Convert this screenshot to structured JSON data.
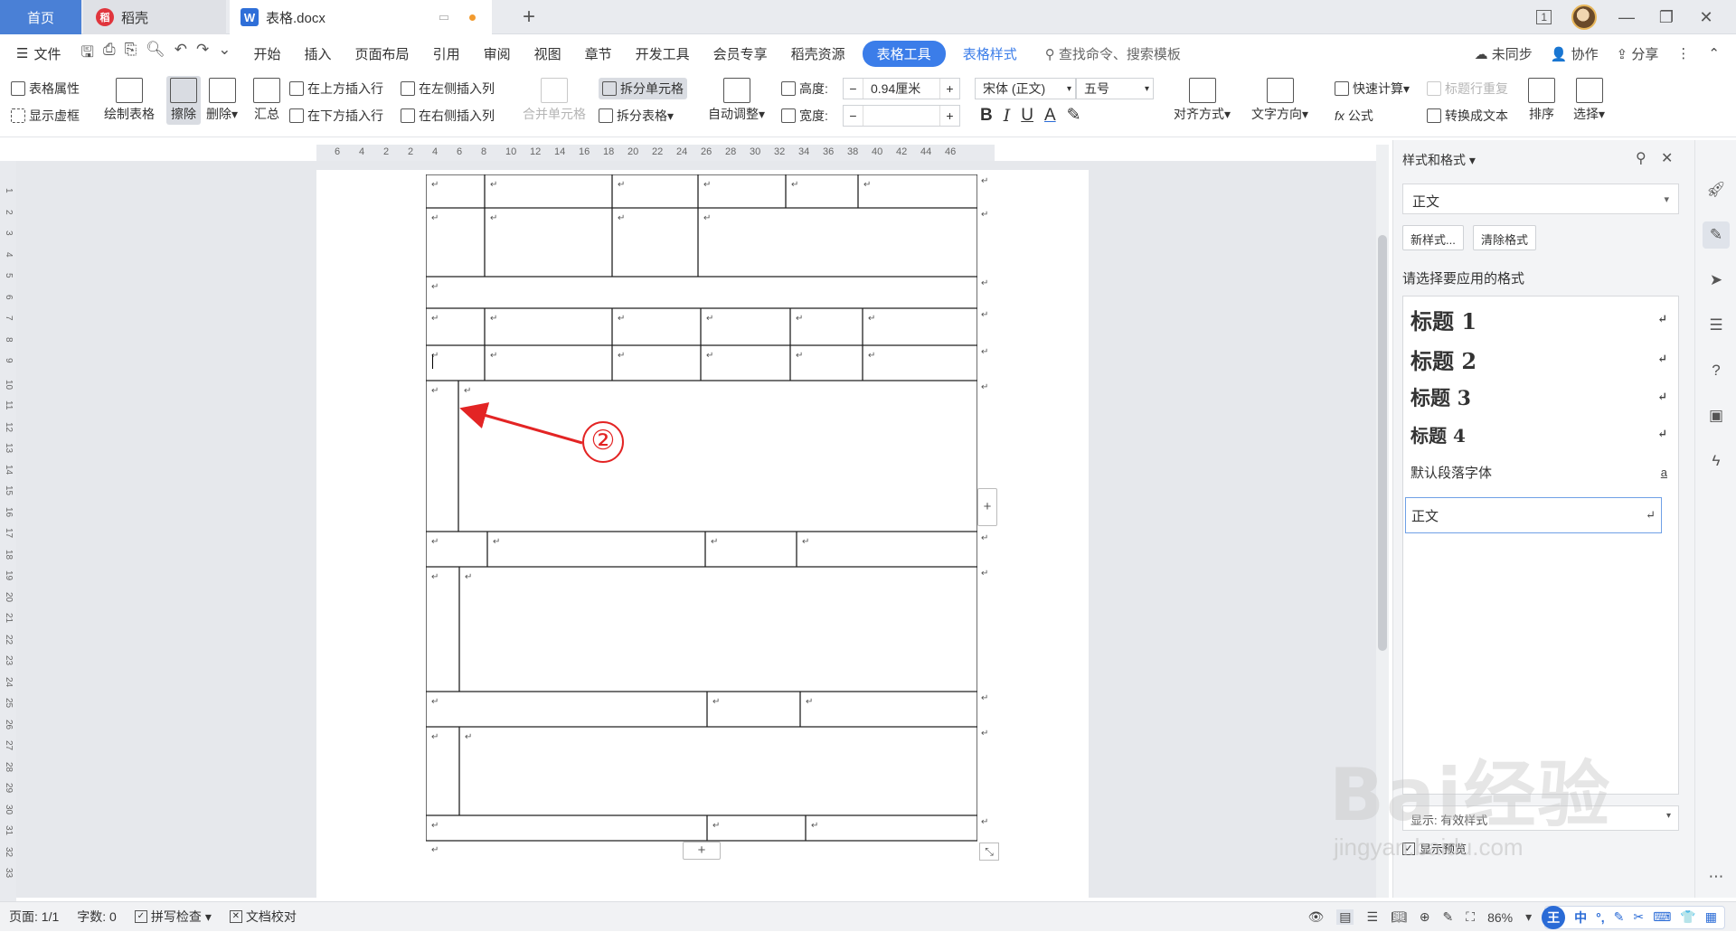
{
  "titlebar": {
    "tab_home": "首页",
    "tab_daoke": "稻壳",
    "tab_doc": "表格.docx",
    "add_tab": "+",
    "page_badge": "1"
  },
  "menubar": {
    "file": "文件",
    "items": [
      "开始",
      "插入",
      "页面布局",
      "引用",
      "审阅",
      "视图",
      "章节",
      "开发工具",
      "会员专享",
      "稻壳资源"
    ],
    "table_tools": "表格工具",
    "table_style": "表格样式",
    "search": "查找命令、搜索模板",
    "sync": "未同步",
    "collab": "协作",
    "share": "分享"
  },
  "ribbon": {
    "table_props": "表格属性",
    "show_grid": "显示虚框",
    "draw_table": "绘制表格",
    "erase": "擦除",
    "delete": "删除",
    "summary": "汇总",
    "insert_above": "在上方插入行",
    "insert_below": "在下方插入行",
    "insert_left": "在左侧插入列",
    "insert_right": "在右侧插入列",
    "merge_cells": "合并单元格",
    "split_cells": "拆分单元格",
    "split_table": "拆分表格",
    "auto_fit": "自动调整",
    "height_label": "高度:",
    "height_value": "0.94厘米",
    "width_label": "宽度:",
    "width_value": "",
    "font_name": "宋体 (正文)",
    "font_size": "五号",
    "bold": "B",
    "italic": "I",
    "underline": "U",
    "font_color": "A",
    "align": "对齐方式",
    "text_dir": "文字方向",
    "quick_calc": "快速计算",
    "repeat_title": "标题行重复",
    "formula": "公式",
    "to_text": "转换成文本",
    "sort": "排序",
    "select": "选择"
  },
  "ruler": {
    "h_ticks": [
      "6",
      "4",
      "2",
      "2",
      "4",
      "6",
      "8",
      "10",
      "12",
      "14",
      "16",
      "18",
      "20",
      "22",
      "24",
      "26",
      "28",
      "30",
      "32",
      "34",
      "36",
      "38",
      "40",
      "42",
      "44",
      "46"
    ],
    "v_ticks": [
      "1",
      "2",
      "3",
      "4",
      "5",
      "6",
      "7",
      "8",
      "9",
      "10",
      "11",
      "12",
      "13",
      "14",
      "15",
      "16",
      "17",
      "18",
      "19",
      "20",
      "21",
      "22",
      "23",
      "24",
      "25",
      "26",
      "27",
      "28",
      "29",
      "30",
      "31",
      "32",
      "33"
    ]
  },
  "doc": {
    "para_mark": "↵",
    "annotation": "②",
    "add_row": "+",
    "add_col": "+",
    "resize": "⤡"
  },
  "pane": {
    "title": "样式和格式",
    "current_style": "正文",
    "new_style": "新样式...",
    "clear_format": "清除格式",
    "choose_label": "请选择要应用的格式",
    "styles": [
      "标题 1",
      "标题 2",
      "标题 3",
      "标题 4",
      "默认段落字体",
      "正文"
    ],
    "default_font_mark": "a",
    "show_label": "显示: 有效样式",
    "preview_label": "显示预览"
  },
  "status": {
    "page": "页面: 1/1",
    "words": "字数: 0",
    "spell": "拼写检查",
    "proof": "文档校对",
    "zoom": "86%",
    "ime": [
      "中",
      "°,",
      "✎",
      "✂",
      "⌨",
      "👕",
      "▦"
    ]
  },
  "watermark": {
    "text": "Bai经验",
    "url": "jingyan.baidu.com"
  },
  "colors": {
    "accent": "#3b7de9",
    "annotation": "#e32424"
  }
}
